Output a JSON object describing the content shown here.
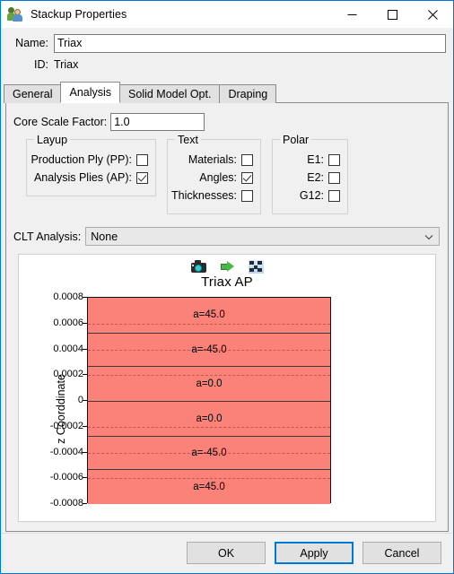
{
  "window": {
    "title": "Stackup Properties",
    "app_icon": "users-icon",
    "controls": {
      "minimize": "minimize",
      "maximize": "maximize",
      "close": "close"
    }
  },
  "header": {
    "name_label": "Name:",
    "name_value": "Triax",
    "id_label": "ID:",
    "id_value": "Triax"
  },
  "tabs": [
    {
      "label": "General",
      "active": false
    },
    {
      "label": "Analysis",
      "active": true
    },
    {
      "label": "Solid Model Opt.",
      "active": false
    },
    {
      "label": "Draping",
      "active": false
    }
  ],
  "analysis": {
    "core_scale_factor_label": "Core Scale Factor:",
    "core_scale_factor_value": "1.0",
    "layup": {
      "title": "Layup",
      "items": [
        {
          "label": "Production Ply (PP):",
          "checked": false
        },
        {
          "label": "Analysis Plies (AP):",
          "checked": true
        }
      ]
    },
    "text": {
      "title": "Text",
      "items": [
        {
          "label": "Materials:",
          "checked": false
        },
        {
          "label": "Angles:",
          "checked": true
        },
        {
          "label": "Thicknesses:",
          "checked": false
        }
      ]
    },
    "polar": {
      "title": "Polar",
      "items": [
        {
          "label": "E1:",
          "checked": false
        },
        {
          "label": "E2:",
          "checked": false
        },
        {
          "label": "G12:",
          "checked": false
        }
      ]
    },
    "clt": {
      "label": "CLT Analysis:",
      "value": "None",
      "chevron": "chevron-down-icon"
    }
  },
  "plot_toolbar": [
    {
      "icon": "camera-icon"
    },
    {
      "icon": "green-arrow-icon"
    },
    {
      "icon": "fit-to-view-icon"
    }
  ],
  "chart_data": {
    "type": "bar",
    "title": "Triax AP",
    "xlabel": "",
    "ylabel": "z Coorddinate",
    "ylim": [
      -0.0008,
      0.0008
    ],
    "yticks": [
      "0.0008",
      "0.0006",
      "0.0004",
      "0.0002",
      "0",
      "-0.0002",
      "-0.0004",
      "-0.0006",
      "-0.0008"
    ],
    "ytick_values": [
      0.0008,
      0.0006,
      0.0004,
      0.0002,
      0,
      -0.0002,
      -0.0004,
      -0.0006,
      -0.0008
    ],
    "grid": true,
    "gridlines_y": [
      0.0006,
      0.0004,
      0.0002,
      -0.0002,
      -0.0004,
      -0.0006
    ],
    "legend": "none",
    "ply_color": "#fb8278",
    "ply_edge_color": "#3b3b3b",
    "plies": [
      {
        "label": "a=45.0",
        "angle": 45,
        "z_top": 0.0008,
        "z_bottom": 0.00053
      },
      {
        "label": "a=-45.0",
        "angle": -45,
        "z_top": 0.00053,
        "z_bottom": 0.00027
      },
      {
        "label": "a=0.0",
        "angle": 0,
        "z_top": 0.00027,
        "z_bottom": 0.0
      },
      {
        "label": "a=0.0",
        "angle": 0,
        "z_top": 0.0,
        "z_bottom": -0.00027
      },
      {
        "label": "a=-45.0",
        "angle": -45,
        "z_top": -0.00027,
        "z_bottom": -0.00053
      },
      {
        "label": "a=45.0",
        "angle": 45,
        "z_top": -0.00053,
        "z_bottom": -0.0008
      }
    ]
  },
  "footer": {
    "ok": "OK",
    "apply": "Apply",
    "cancel": "Cancel"
  }
}
